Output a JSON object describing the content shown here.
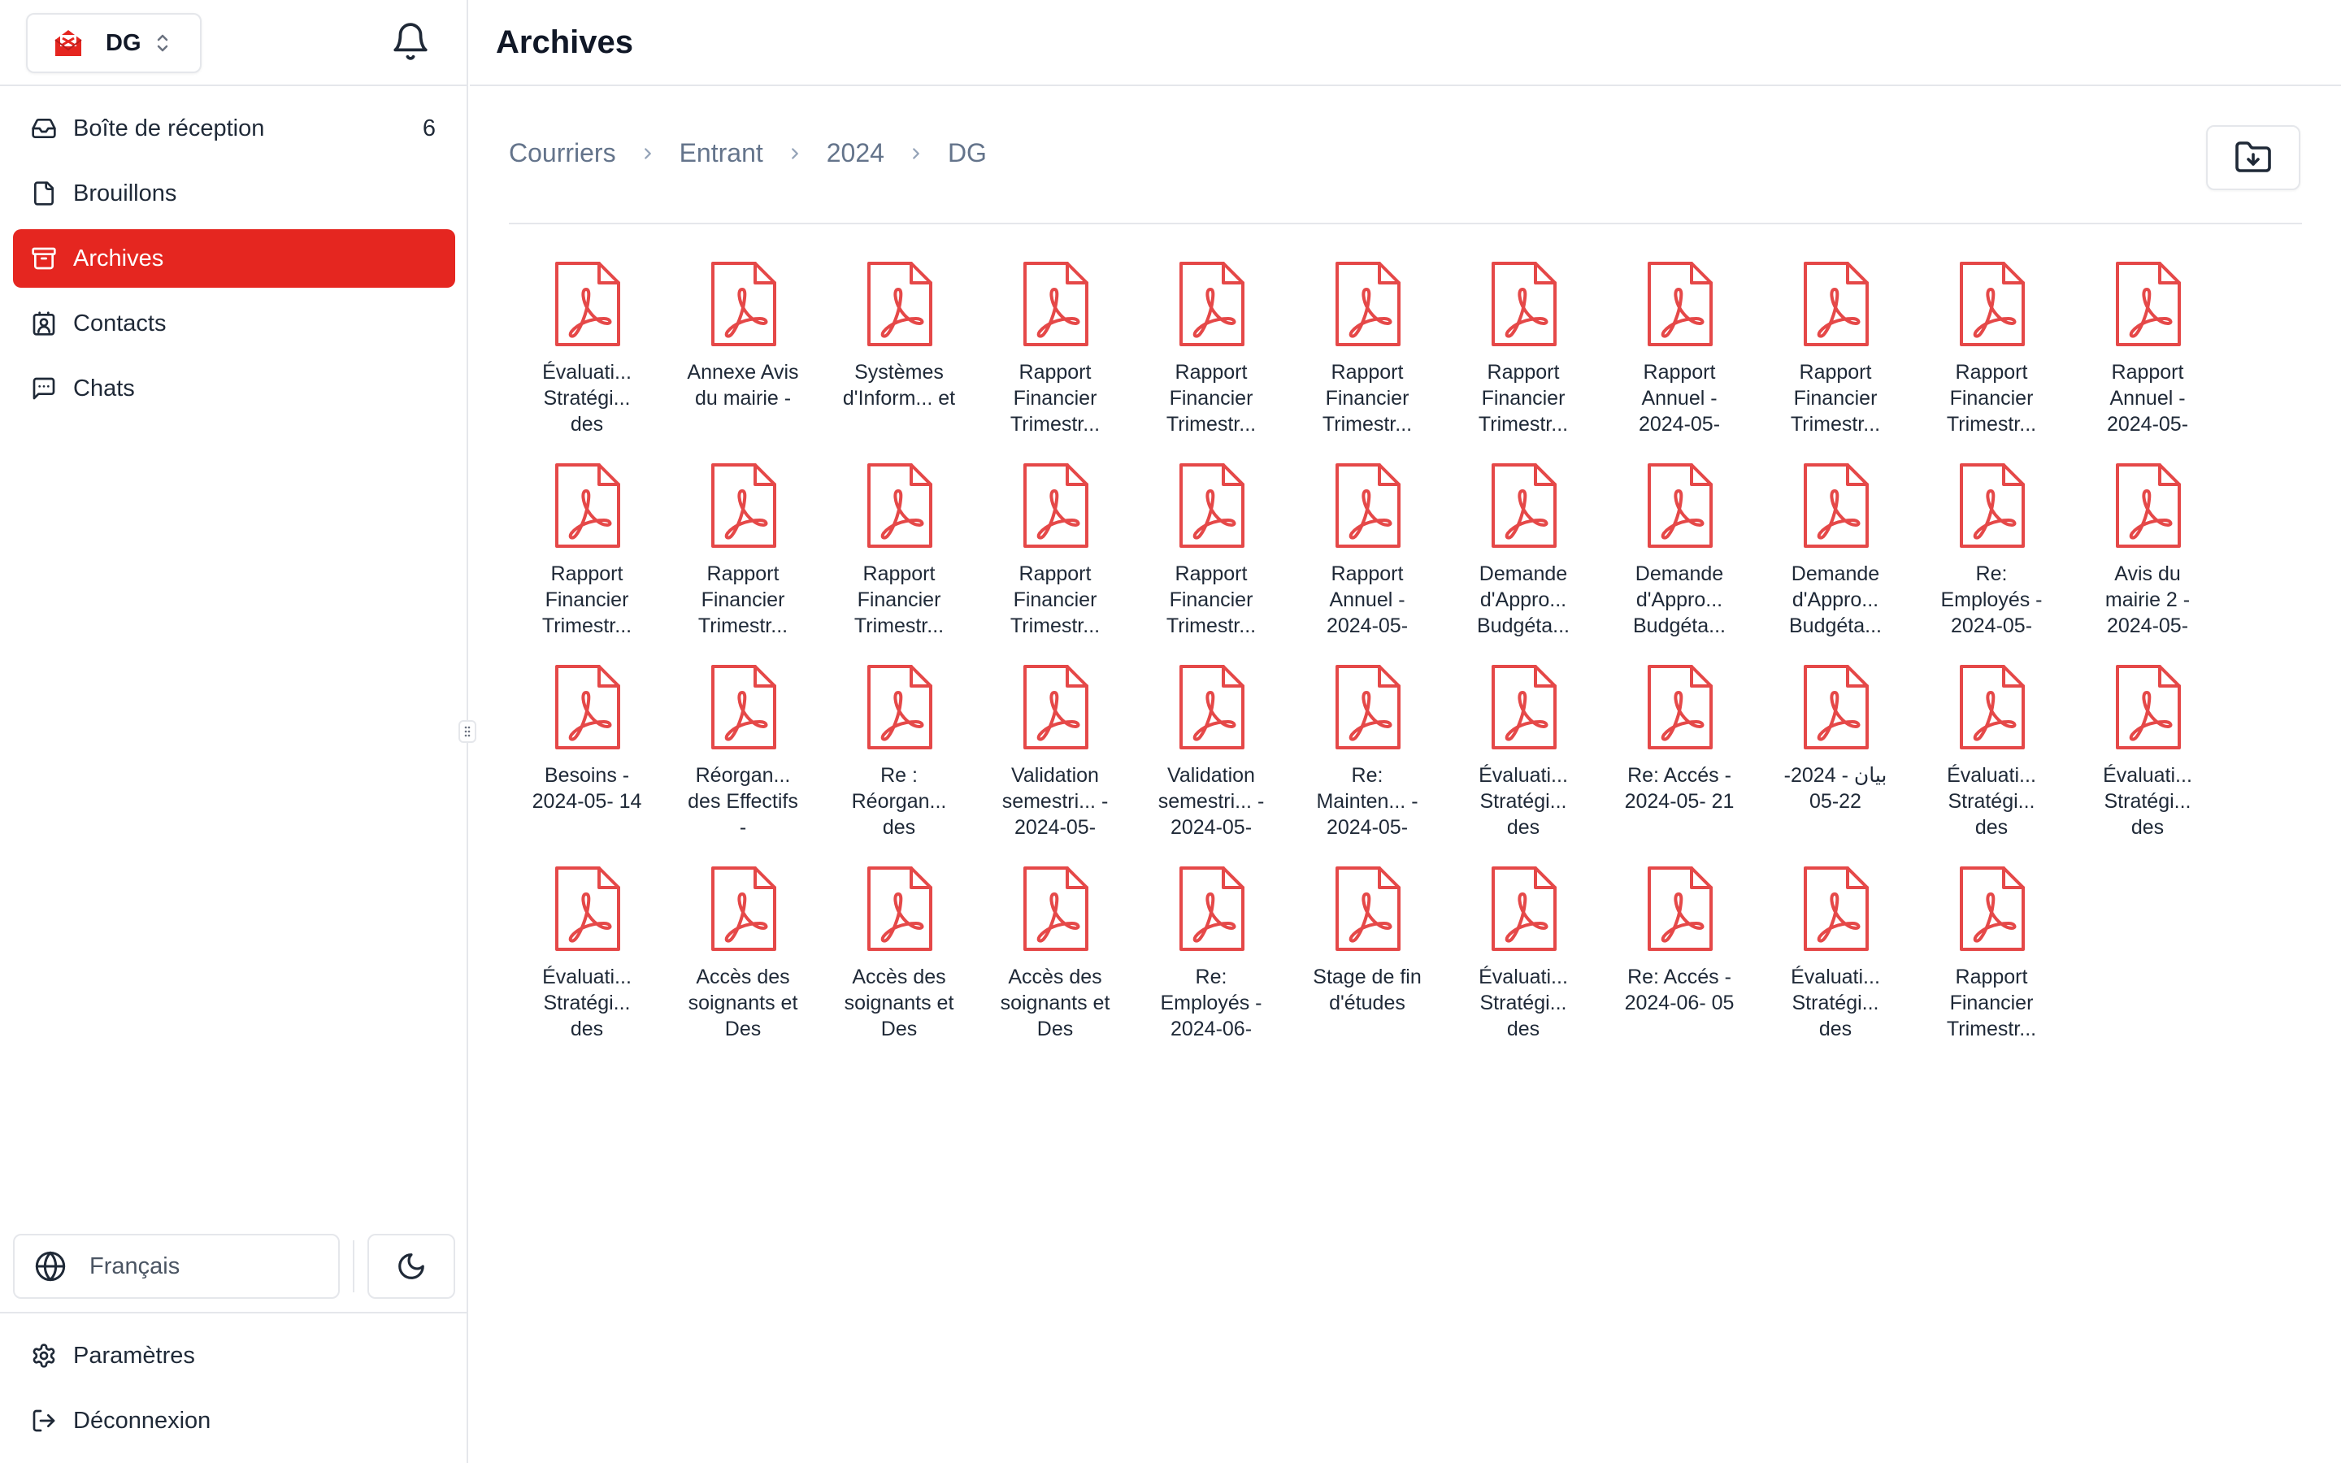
{
  "sidebar": {
    "org_name": "DG",
    "nav": [
      {
        "label": "Boîte de réception",
        "count": "6",
        "icon": "inbox-icon"
      },
      {
        "label": "Brouillons",
        "icon": "file-icon"
      },
      {
        "label": "Archives",
        "icon": "archive-icon",
        "active": true
      },
      {
        "label": "Contacts",
        "icon": "contact-icon"
      },
      {
        "label": "Chats",
        "icon": "chat-icon"
      }
    ],
    "language": "Français",
    "bottom_nav": [
      {
        "label": "Paramètres",
        "icon": "gear-icon"
      },
      {
        "label": "Déconnexion",
        "icon": "logout-icon"
      }
    ]
  },
  "header": {
    "title": "Archives"
  },
  "breadcrumb": [
    "Courriers",
    "Entrant",
    "2024",
    "DG"
  ],
  "colors": {
    "accent": "#e52620",
    "pdf_icon": "#e54848"
  },
  "files": [
    "Évaluati... Stratégi... des",
    "Annexe Avis du mairie -",
    "Systèmes d'Inform... et",
    "Rapport Financier Trimestr...",
    "Rapport Financier Trimestr...",
    "Rapport Financier Trimestr...",
    "Rapport Financier Trimestr...",
    "Rapport Annuel - 2024-05-",
    "Rapport Financier Trimestr...",
    "Rapport Financier Trimestr...",
    "Rapport Annuel - 2024-05-",
    "Rapport Financier Trimestr...",
    "Rapport Financier Trimestr...",
    "Rapport Financier Trimestr...",
    "Rapport Financier Trimestr...",
    "Rapport Financier Trimestr...",
    "Rapport Annuel - 2024-05-",
    "Demande d'Appro... Budgéta...",
    "Demande d'Appro... Budgéta...",
    "Demande d'Appro... Budgéta...",
    "Re: Employés - 2024-05-",
    "Avis du mairie 2 - 2024-05-",
    "Besoins - 2024-05- 14",
    "Réorgan... des Effectifs -",
    "Re : Réorgan... des",
    "Validation semestri... - 2024-05-",
    "Validation semestri... - 2024-05-",
    "Re: Mainten... - 2024-05-",
    "Évaluati... Stratégi... des",
    "Re: Accés - 2024-05- 21",
    "بيان - 2024- 22-05",
    "Évaluati... Stratégi... des",
    "Évaluati... Stratégi... des",
    "Évaluati... Stratégi... des",
    "Accès des soignants et Des",
    "Accès des soignants et Des",
    "Accès des soignants et Des",
    "Re: Employés - 2024-06-",
    "Stage de fin d'études",
    "Évaluati... Stratégi... des",
    "Re: Accés - 2024-06- 05",
    "Évaluati... Stratégi... des",
    "Rapport Financier Trimestr..."
  ]
}
